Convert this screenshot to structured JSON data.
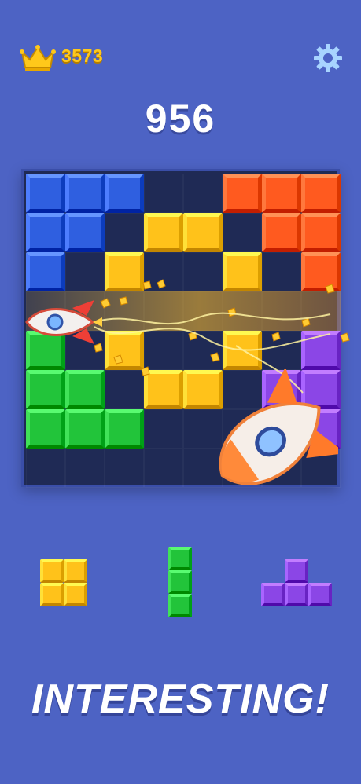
{
  "header": {
    "best_score": "3573",
    "crown_icon": "crown-icon",
    "settings_icon": "gear-icon"
  },
  "score": "956",
  "colors": {
    "background": "#4d63c4",
    "board": "#1f2a55",
    "blue": "#2f5fe0",
    "orange": "#ff5a1f",
    "yellow": "#ffc21a",
    "green": "#22c43a",
    "purple": "#8b46e6"
  },
  "board": {
    "rows": [
      [
        "B",
        "B",
        "B",
        ".",
        ".",
        "O",
        "O",
        "O"
      ],
      [
        "B",
        "B",
        ".",
        "Y",
        "Y",
        ".",
        "O",
        "O"
      ],
      [
        "B",
        ".",
        "Y",
        ".",
        ".",
        "Y",
        ".",
        "O"
      ],
      [
        ".",
        ".",
        ".",
        ".",
        ".",
        ".",
        ".",
        "."
      ],
      [
        "G",
        ".",
        "Y",
        ".",
        ".",
        "Y",
        ".",
        "P"
      ],
      [
        "G",
        "G",
        ".",
        "Y",
        "Y",
        ".",
        "P",
        "P"
      ],
      [
        "G",
        "G",
        "G",
        ".",
        ".",
        ".",
        "P",
        "P"
      ],
      [
        ".",
        ".",
        ".",
        ".",
        ".",
        ".",
        ".",
        "."
      ]
    ],
    "cleared_row": 4,
    "effect": "rocket clearing row"
  },
  "tray": [
    {
      "name": "square",
      "color": "Y",
      "shape": [
        [
          "Y",
          "Y"
        ],
        [
          "Y",
          "Y"
        ]
      ]
    },
    {
      "name": "vertical-line",
      "color": "G",
      "shape": [
        [
          "G"
        ],
        [
          "G"
        ],
        [
          "G"
        ]
      ]
    },
    {
      "name": "t-piece",
      "color": "P",
      "shape": [
        [
          ".",
          "P",
          "."
        ],
        [
          "P",
          "P",
          "P"
        ]
      ]
    }
  ],
  "slogan": "INTERESTING!"
}
